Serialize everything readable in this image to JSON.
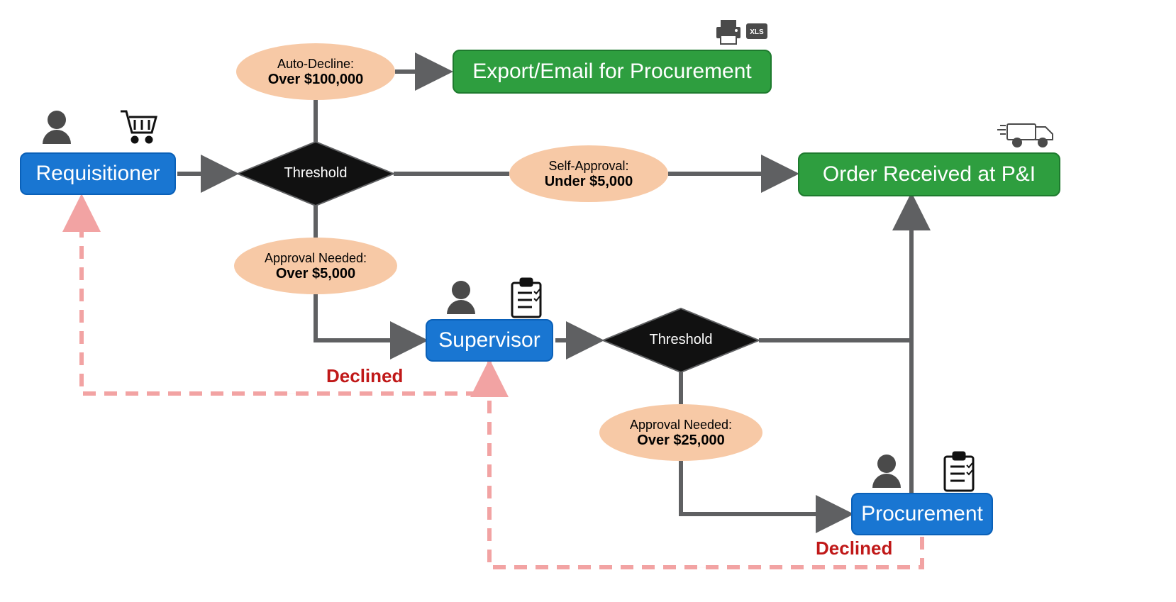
{
  "roles": {
    "requisitioner": "Requisitioner",
    "supervisor": "Supervisor",
    "procurement": "Procurement"
  },
  "terminals": {
    "export": "Export/Email for Procurement",
    "received": "Order Received at P&I"
  },
  "decisions": {
    "threshold1": "Threshold",
    "threshold2": "Threshold"
  },
  "conditions": {
    "auto_decline": {
      "lab": "Auto-Decline:",
      "val": "Over $100,000"
    },
    "self_approval": {
      "lab": "Self-Approval:",
      "val": "Under $5,000"
    },
    "approval_5k": {
      "lab": "Approval Needed:",
      "val": "Over $5,000"
    },
    "approval_25k": {
      "lab": "Approval Needed:",
      "val": "Over $25,000"
    }
  },
  "declined": {
    "from_supervisor": "Declined",
    "from_procurement": "Declined"
  },
  "colors": {
    "role": "#1976d2",
    "terminal": "#2e9e3f",
    "condition_fill": "#f7c9a6",
    "arrow": "#5f6062",
    "declined_line": "#f2a3a3",
    "declined_text": "#c01818",
    "decision_fill": "#111111"
  },
  "icons": {
    "user": "user-icon",
    "cart": "cart-icon",
    "clipboard": "clipboard-icon",
    "printer": "printer-icon",
    "xls": "xls-icon",
    "truck": "truck-icon"
  }
}
